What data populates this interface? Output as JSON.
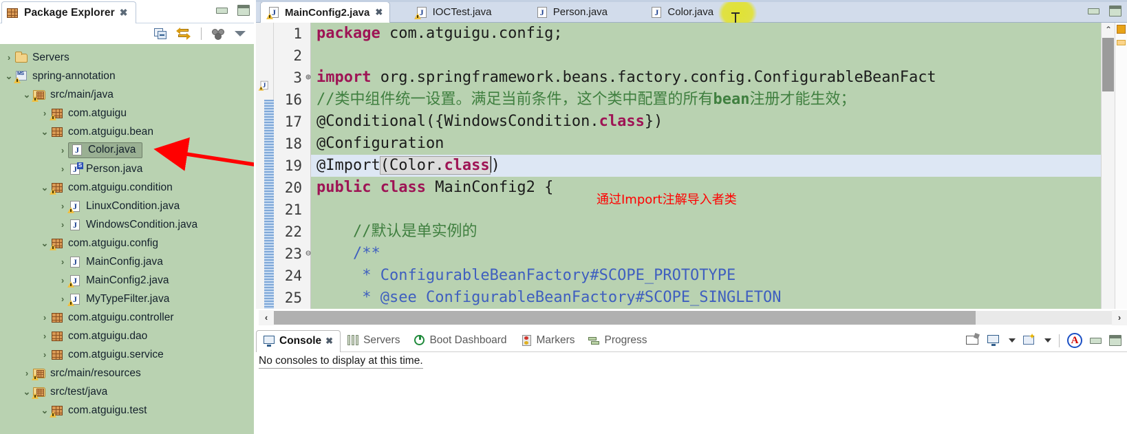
{
  "explorer": {
    "tab_title": "Package Explorer",
    "close_glyph": "✖",
    "toolbar": [
      {
        "name": "collapse-all-icon",
        "label": "Collapse All"
      },
      {
        "name": "link-with-editor-icon",
        "label": "Link with Editor"
      },
      {
        "name": "view-menu-icon",
        "label": "View Menu"
      },
      {
        "name": "chevron-down-icon",
        "label": "Menu"
      }
    ],
    "tree": [
      {
        "label": "Servers",
        "depth": 0,
        "twist": ">",
        "icon": "folder"
      },
      {
        "label": "spring-annotation",
        "depth": 0,
        "twist": "v",
        "icon": "project"
      },
      {
        "label": "src/main/java",
        "depth": 1,
        "twist": "v",
        "icon": "source-folder"
      },
      {
        "label": "com.atguigu",
        "depth": 2,
        "twist": ">",
        "icon": "package-warn"
      },
      {
        "label": "com.atguigu.bean",
        "depth": 2,
        "twist": "v",
        "icon": "package"
      },
      {
        "label": "Color.java",
        "depth": 3,
        "twist": ">",
        "icon": "java-class",
        "selected": true
      },
      {
        "label": "Person.java",
        "depth": 3,
        "twist": ">",
        "icon": "java-class-s"
      },
      {
        "label": "com.atguigu.condition",
        "depth": 2,
        "twist": "v",
        "icon": "package-warn"
      },
      {
        "label": "LinuxCondition.java",
        "depth": 3,
        "twist": ">",
        "icon": "java-class-warn"
      },
      {
        "label": "WindowsCondition.java",
        "depth": 3,
        "twist": ">",
        "icon": "java-class"
      },
      {
        "label": "com.atguigu.config",
        "depth": 2,
        "twist": "v",
        "icon": "package-warn"
      },
      {
        "label": "MainConfig.java",
        "depth": 3,
        "twist": ">",
        "icon": "java-class"
      },
      {
        "label": "MainConfig2.java",
        "depth": 3,
        "twist": ">",
        "icon": "java-class-warn"
      },
      {
        "label": "MyTypeFilter.java",
        "depth": 3,
        "twist": ">",
        "icon": "java-class-warn"
      },
      {
        "label": "com.atguigu.controller",
        "depth": 2,
        "twist": ">",
        "icon": "package"
      },
      {
        "label": "com.atguigu.dao",
        "depth": 2,
        "twist": ">",
        "icon": "package"
      },
      {
        "label": "com.atguigu.service",
        "depth": 2,
        "twist": ">",
        "icon": "package"
      },
      {
        "label": "src/main/resources",
        "depth": 1,
        "twist": ">",
        "icon": "source-folder"
      },
      {
        "label": "src/test/java",
        "depth": 1,
        "twist": "v",
        "icon": "source-folder-warn"
      },
      {
        "label": "com.atguigu.test",
        "depth": 2,
        "twist": "v",
        "icon": "package-warn"
      }
    ]
  },
  "editor": {
    "tabs": [
      {
        "label": "MainConfig2.java",
        "active": true,
        "icon": "java-class-warn",
        "close": "✖"
      },
      {
        "label": "IOCTest.java",
        "active": false,
        "icon": "java-class-warn"
      },
      {
        "label": "Person.java",
        "active": false,
        "icon": "java-class"
      },
      {
        "label": "Color.java",
        "active": false,
        "icon": "java-class"
      }
    ],
    "lines": [
      {
        "num": "1",
        "fold": "",
        "html": "<span class=\"kw\">package</span> com.atguigu.config;",
        "mark": ""
      },
      {
        "num": "2",
        "fold": "",
        "html": "",
        "mark": ""
      },
      {
        "num": "3",
        "fold": "⊕",
        "html": "<span class=\"kw\">import</span> org.springframework.beans.factory.config.ConfigurableBeanFact",
        "mark": "import-collapsed"
      },
      {
        "num": "16",
        "fold": "",
        "html": "<span class=\"cmt\">//类中组件统一设置。满足当前条件，这个类中配置的所有<b>bean</b>注册才能生效；</span>",
        "mark": "changed"
      },
      {
        "num": "17",
        "fold": "",
        "html": "@Conditional({WindowsCondition.<span class=\"kw\">class</span>})",
        "mark": "changed"
      },
      {
        "num": "18",
        "fold": "",
        "html": "@Configuration",
        "mark": "changed"
      },
      {
        "num": "19",
        "fold": "",
        "html": "@Import<span class=\"sel-box\">(Color.<span class=\"kw\">class</span></span><span class=\"caret-blk\"></span>)",
        "mark": "changed",
        "highlight": true
      },
      {
        "num": "20",
        "fold": "",
        "html": "<span class=\"kw\">public</span> <span class=\"kw\">class</span> MainConfig2 {",
        "mark": "changed"
      },
      {
        "num": "21",
        "fold": "",
        "html": "",
        "mark": "changed"
      },
      {
        "num": "22",
        "fold": "",
        "html": "    <span class=\"cmt\">//默认是单实例的</span>",
        "mark": "changed"
      },
      {
        "num": "23",
        "fold": "⊖",
        "html": "    <span class=\"jdoc\">/**</span>",
        "mark": "changed"
      },
      {
        "num": "24",
        "fold": "",
        "html": "     <span class=\"jdoc\">* ConfigurableBeanFactory#SCOPE_PROTOTYPE</span>",
        "mark": "changed"
      },
      {
        "num": "25",
        "fold": "",
        "html": "     <span class=\"jdoc\">* @see ConfigurableBeanFactory#SCOPE_SINGLETON</span>",
        "mark": "changed"
      }
    ],
    "annotation": "通过Import注解导入者类",
    "annotation_color": "#ff0000",
    "hscroll_left_glyph": "‹",
    "hscroll_right_glyph": "›",
    "vscroll_up_glyph": "⌃",
    "vscroll_down_glyph": "⌄"
  },
  "console": {
    "tabs": [
      {
        "label": "Console",
        "active": true,
        "icon": "console-icon",
        "close": "✖"
      },
      {
        "label": "Servers",
        "active": false,
        "icon": "servers-icon"
      },
      {
        "label": "Boot Dashboard",
        "active": false,
        "icon": "boot-dashboard-icon"
      },
      {
        "label": "Markers",
        "active": false,
        "icon": "markers-icon"
      },
      {
        "label": "Progress",
        "active": false,
        "icon": "progress-icon"
      }
    ],
    "message": "No consoles to display at this time.",
    "toolbar": [
      {
        "name": "open-console-icon"
      },
      {
        "name": "display-selected-console-icon"
      },
      {
        "name": "display-selected-console-dropdown-icon"
      },
      {
        "name": "new-console-view-icon"
      },
      {
        "name": "new-console-view-dropdown-icon"
      },
      {
        "name": "pin-console-icon"
      }
    ]
  },
  "colors": {
    "tree_bg": "#b9d2b1",
    "code_bg": "#b9d2b1",
    "tab_strip_bg": "#d2dceb",
    "highlight_line": "#dde7f4",
    "annotation_red": "#ff0000",
    "cursor_halo": "#e2e228",
    "arrow_red": "#ff0000"
  }
}
